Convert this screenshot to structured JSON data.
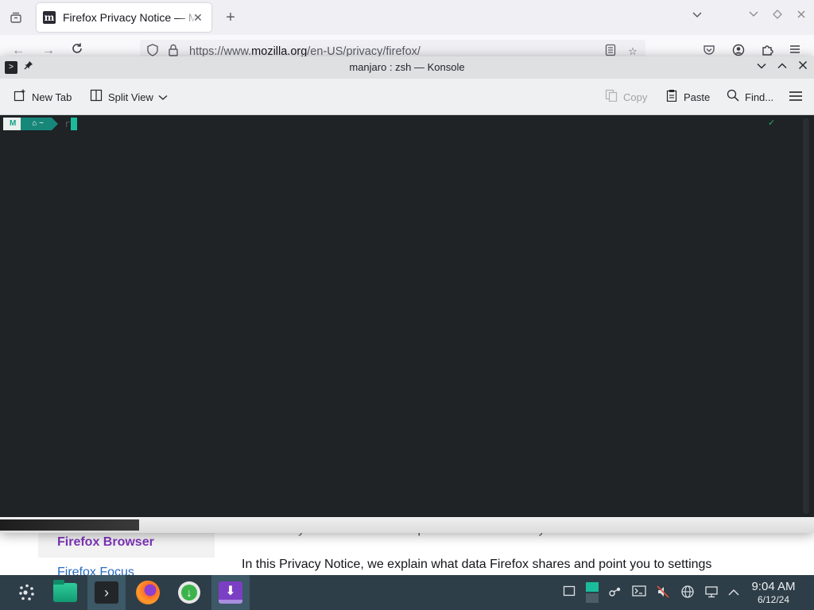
{
  "firefox": {
    "tab": {
      "title": "Firefox Privacy Notice — Mozilla",
      "favicon_letter": "m",
      "close_glyph": "✕"
    },
    "new_tab_glyph": "+",
    "url": {
      "prefix": "https://www.",
      "domain": "mozilla.org",
      "path": "/en-US/privacy/firefox/"
    },
    "icons": [
      "tab-list-icon",
      "back-icon",
      "forward-icon",
      "reload-icon",
      "shield-icon",
      "lock-icon",
      "reader-mode-icon",
      "bookmark-star-icon",
      "pocket-icon",
      "account-icon",
      "extensions-icon",
      "menu-icon"
    ],
    "page": {
      "sidebar_active": "Firefox Browser",
      "sidebar_next": "Firefox Focus",
      "text_partial": "collect only what we need to improve Firefox for everyone.",
      "text_line": "In this Privacy Notice, we explain what data Firefox shares and point you to settings"
    }
  },
  "konsole": {
    "title": "manjaro : zsh — Konsole",
    "toolbar": {
      "new_tab": "New Tab",
      "split_view": "Split View",
      "copy": "Copy",
      "paste": "Paste",
      "find": "Find..."
    },
    "prompt": {
      "os_glyph": "M",
      "dir": "~",
      "input": "r",
      "status": "✓"
    }
  },
  "taskbar": {
    "apps": [
      "application-launcher",
      "dolphin-file-manager",
      "konsole",
      "firefox",
      "downloader",
      "installer"
    ],
    "clock": {
      "time": "9:04 AM",
      "date": "6/12/24"
    },
    "colors": {
      "panel": "#2e3e48",
      "accent": "#1abc9c"
    }
  }
}
